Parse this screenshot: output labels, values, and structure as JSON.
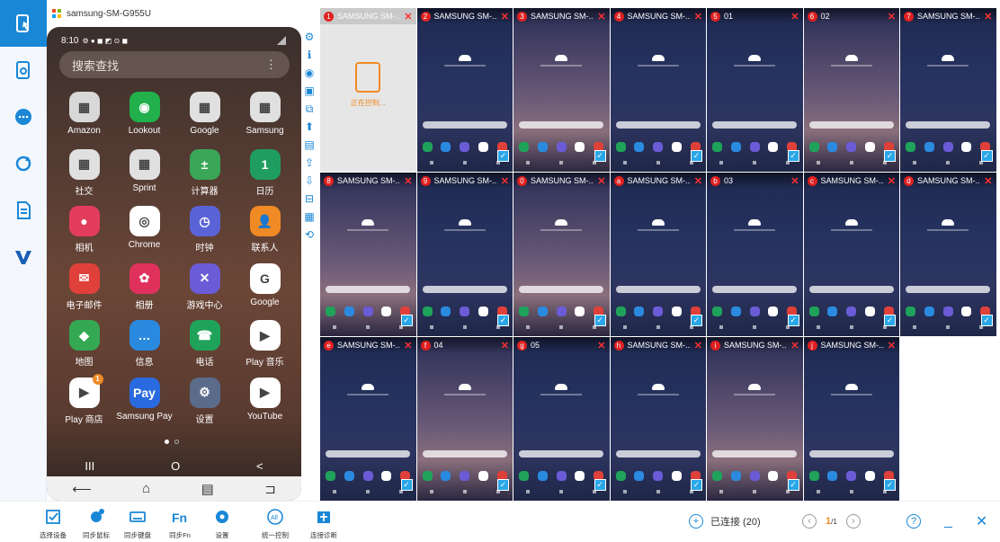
{
  "left_nav": [
    "phone-screen-icon",
    "screenshot-icon",
    "chat-icon",
    "sync-icon",
    "file-icon",
    "v-logo-icon"
  ],
  "device_title": "samsung-SM-G955U",
  "phone": {
    "time": "8:10",
    "search_placeholder": "搜索查找",
    "apps": [
      {
        "label": "Amazon",
        "color": "#d8d8d8",
        "glyph": "▦"
      },
      {
        "label": "Lookout",
        "color": "#21b04b",
        "glyph": "◉"
      },
      {
        "label": "Google",
        "color": "#e0e0e0",
        "glyph": "▦"
      },
      {
        "label": "Samsung",
        "color": "#e0e0e0",
        "glyph": "▦"
      },
      {
        "label": "社交",
        "color": "#e0e0e0",
        "glyph": "▦"
      },
      {
        "label": "Sprint",
        "color": "#e0e0e0",
        "glyph": "▦"
      },
      {
        "label": "计算器",
        "color": "#3aa657",
        "glyph": "±"
      },
      {
        "label": "日历",
        "color": "#1f9d60",
        "glyph": "1"
      },
      {
        "label": "相机",
        "color": "#e23d5d",
        "glyph": "●"
      },
      {
        "label": "Chrome",
        "color": "#ffffff",
        "glyph": "◎"
      },
      {
        "label": "时钟",
        "color": "#5a63d6",
        "glyph": "◷"
      },
      {
        "label": "联系人",
        "color": "#f08a24",
        "glyph": "👤"
      },
      {
        "label": "电子邮件",
        "color": "#e0403a",
        "glyph": "✉"
      },
      {
        "label": "相册",
        "color": "#e0315d",
        "glyph": "✿"
      },
      {
        "label": "游戏中心",
        "color": "#6b5bd6",
        "glyph": "✕"
      },
      {
        "label": "Google",
        "color": "#ffffff",
        "glyph": "G"
      },
      {
        "label": "地图",
        "color": "#34a853",
        "glyph": "◆"
      },
      {
        "label": "信息",
        "color": "#2a8ae0",
        "glyph": "…"
      },
      {
        "label": "电话",
        "color": "#1fa35a",
        "glyph": "☎"
      },
      {
        "label": "Play 音乐",
        "color": "#ffffff",
        "glyph": "▶"
      },
      {
        "label": "Play 商店",
        "color": "#ffffff",
        "glyph": "▶"
      },
      {
        "label": "Samsung Pay",
        "color": "#2a6ae0",
        "glyph": "Pay"
      },
      {
        "label": "设置",
        "color": "#5b6b8a",
        "glyph": "⚙"
      },
      {
        "label": "YouTube",
        "color": "#ffffff",
        "glyph": "▶"
      }
    ],
    "nav_keys": [
      "III",
      "O",
      "<"
    ],
    "soft_keys": [
      "⟵",
      "⌂",
      "▤",
      "⊐"
    ]
  },
  "side_tools": [
    "gear-icon",
    "info-icon",
    "settings-circle-icon",
    "screen-icon",
    "copy-icon",
    "pin-icon",
    "doc-icon",
    "upload-icon",
    "download-icon",
    "split-icon",
    "grid-icon",
    "rotate-icon"
  ],
  "devices": [
    {
      "num": "1",
      "name": "SAMSUNG SM-...",
      "controlling": true
    },
    {
      "num": "2",
      "name": "SAMSUNG SM-...",
      "style": "blue"
    },
    {
      "num": "3",
      "name": "SAMSUNG SM-...",
      "style": "pink"
    },
    {
      "num": "4",
      "name": "SAMSUNG SM-...",
      "style": "blue"
    },
    {
      "num": "5",
      "name": "01",
      "style": "blue"
    },
    {
      "num": "6",
      "name": "02",
      "style": "pink"
    },
    {
      "num": "7",
      "name": "SAMSUNG SM-...",
      "style": "blue"
    },
    {
      "num": "8",
      "name": "SAMSUNG SM-...",
      "style": "pink"
    },
    {
      "num": "9",
      "name": "SAMSUNG SM-...",
      "style": "blue"
    },
    {
      "num": "0",
      "name": "SAMSUNG SM-...",
      "style": "pink"
    },
    {
      "num": "a",
      "name": "SAMSUNG SM-...",
      "style": "blue"
    },
    {
      "num": "b",
      "name": "03",
      "style": "blue"
    },
    {
      "num": "c",
      "name": "SAMSUNG SM-...",
      "style": "blue"
    },
    {
      "num": "d",
      "name": "SAMSUNG SM-...",
      "style": "blue"
    },
    {
      "num": "e",
      "name": "SAMSUNG SM-...",
      "style": "blue"
    },
    {
      "num": "f",
      "name": "04",
      "style": "pink"
    },
    {
      "num": "g",
      "name": "05",
      "style": "blue"
    },
    {
      "num": "h",
      "name": "SAMSUNG SM-...",
      "style": "blue"
    },
    {
      "num": "i",
      "name": "SAMSUNG SM-...",
      "style": "pink"
    },
    {
      "num": "j",
      "name": "SAMSUNG SM-...",
      "style": "blue"
    }
  ],
  "controlling_text": "正在控制...",
  "toolbar": [
    {
      "label": "选择设备",
      "icon": "select-device-icon"
    },
    {
      "label": "同步鼠标",
      "icon": "sync-mouse-icon"
    },
    {
      "label": "同步键盘",
      "icon": "sync-keyboard-icon"
    },
    {
      "label": "同步Fn",
      "icon": "sync-fn-icon"
    },
    {
      "label": "设置",
      "icon": "settings-icon"
    },
    {
      "label": "统一控制",
      "icon": "unified-control-icon"
    },
    {
      "label": "连接诊断",
      "icon": "connection-diagnosis-icon"
    }
  ],
  "connected_label": "已连接 (20)",
  "page": {
    "current": "1",
    "total": "/1"
  },
  "accent": "#1a87d6"
}
